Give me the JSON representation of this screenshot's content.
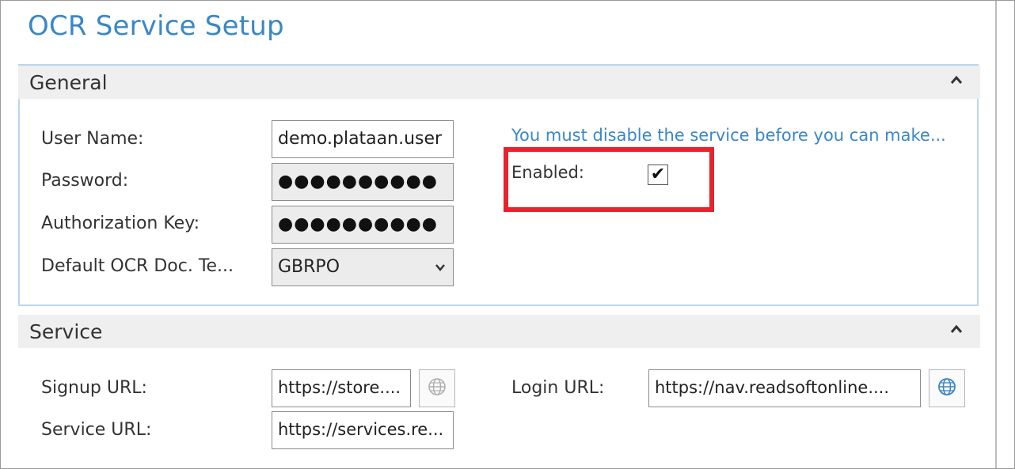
{
  "title": "OCR Service Setup",
  "general": {
    "label": "General",
    "collapse_icon": "chevron-up-icon",
    "user_name_label": "User Name:",
    "user_name_value": "demo.plataan.user",
    "password_label": "Password:",
    "password_value": "●●●●●●●●●●",
    "auth_key_label": "Authorization Key:",
    "auth_key_value": "●●●●●●●●●●",
    "default_template_label": "Default OCR Doc. Te...",
    "default_template_value": "GBRPO",
    "note": "You must disable the service before you can make...",
    "enabled_label": "Enabled:",
    "enabled_checked": true,
    "check_glyph": "✔"
  },
  "service": {
    "label": "Service",
    "collapse_icon": "chevron-up-icon",
    "signup_url_label": "Signup URL:",
    "signup_url_value": "https://store....",
    "service_url_label": "Service URL:",
    "service_url_value": "https://services.re...",
    "login_url_label": "Login URL:",
    "login_url_value": "https://nav.readsoftonline...."
  },
  "colors": {
    "accent": "#3a87c8",
    "highlight": "#e8232e"
  }
}
